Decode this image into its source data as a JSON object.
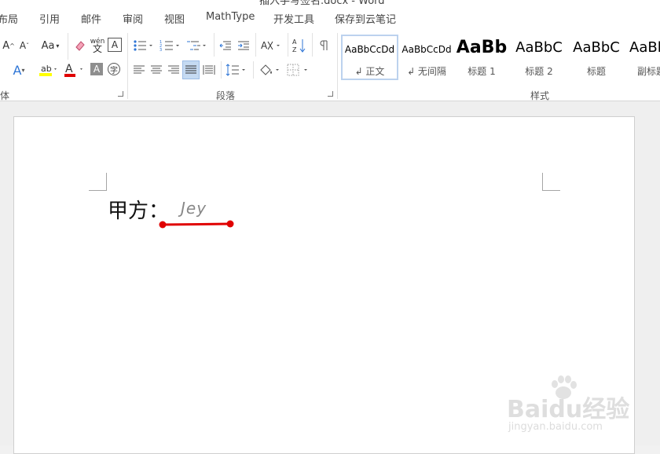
{
  "window": {
    "title": "插入手写签名.docx - Word"
  },
  "menu": [
    "布局",
    "引用",
    "邮件",
    "审阅",
    "视图",
    "MathType",
    "开发工具",
    "保存到云笔记"
  ],
  "ribbon": {
    "font_row1": [
      "A^",
      "A˅",
      "Aa",
      "wén",
      "A"
    ],
    "groups": [
      "体",
      "段落",
      "样式"
    ],
    "styles": [
      {
        "preview": "AaBbCcDd",
        "name": "↲ 正文"
      },
      {
        "preview": "AaBbCcDd",
        "name": "↲ 无间隔"
      },
      {
        "preview": "AaBb",
        "name": "标题 1"
      },
      {
        "preview": "AaBbC",
        "name": "标题 2"
      },
      {
        "preview": "AaBbC",
        "name": "标题"
      },
      {
        "preview": "AaBl",
        "name": "副标题"
      }
    ]
  },
  "document": {
    "label": "甲方：",
    "signature": "Jey"
  },
  "watermark": {
    "logo": "Baidu经验",
    "url": "jingyan.baidu.com"
  },
  "colors": {
    "highlight": "#ffff00",
    "font_color": "#e00000",
    "annotation": "#e00000"
  }
}
